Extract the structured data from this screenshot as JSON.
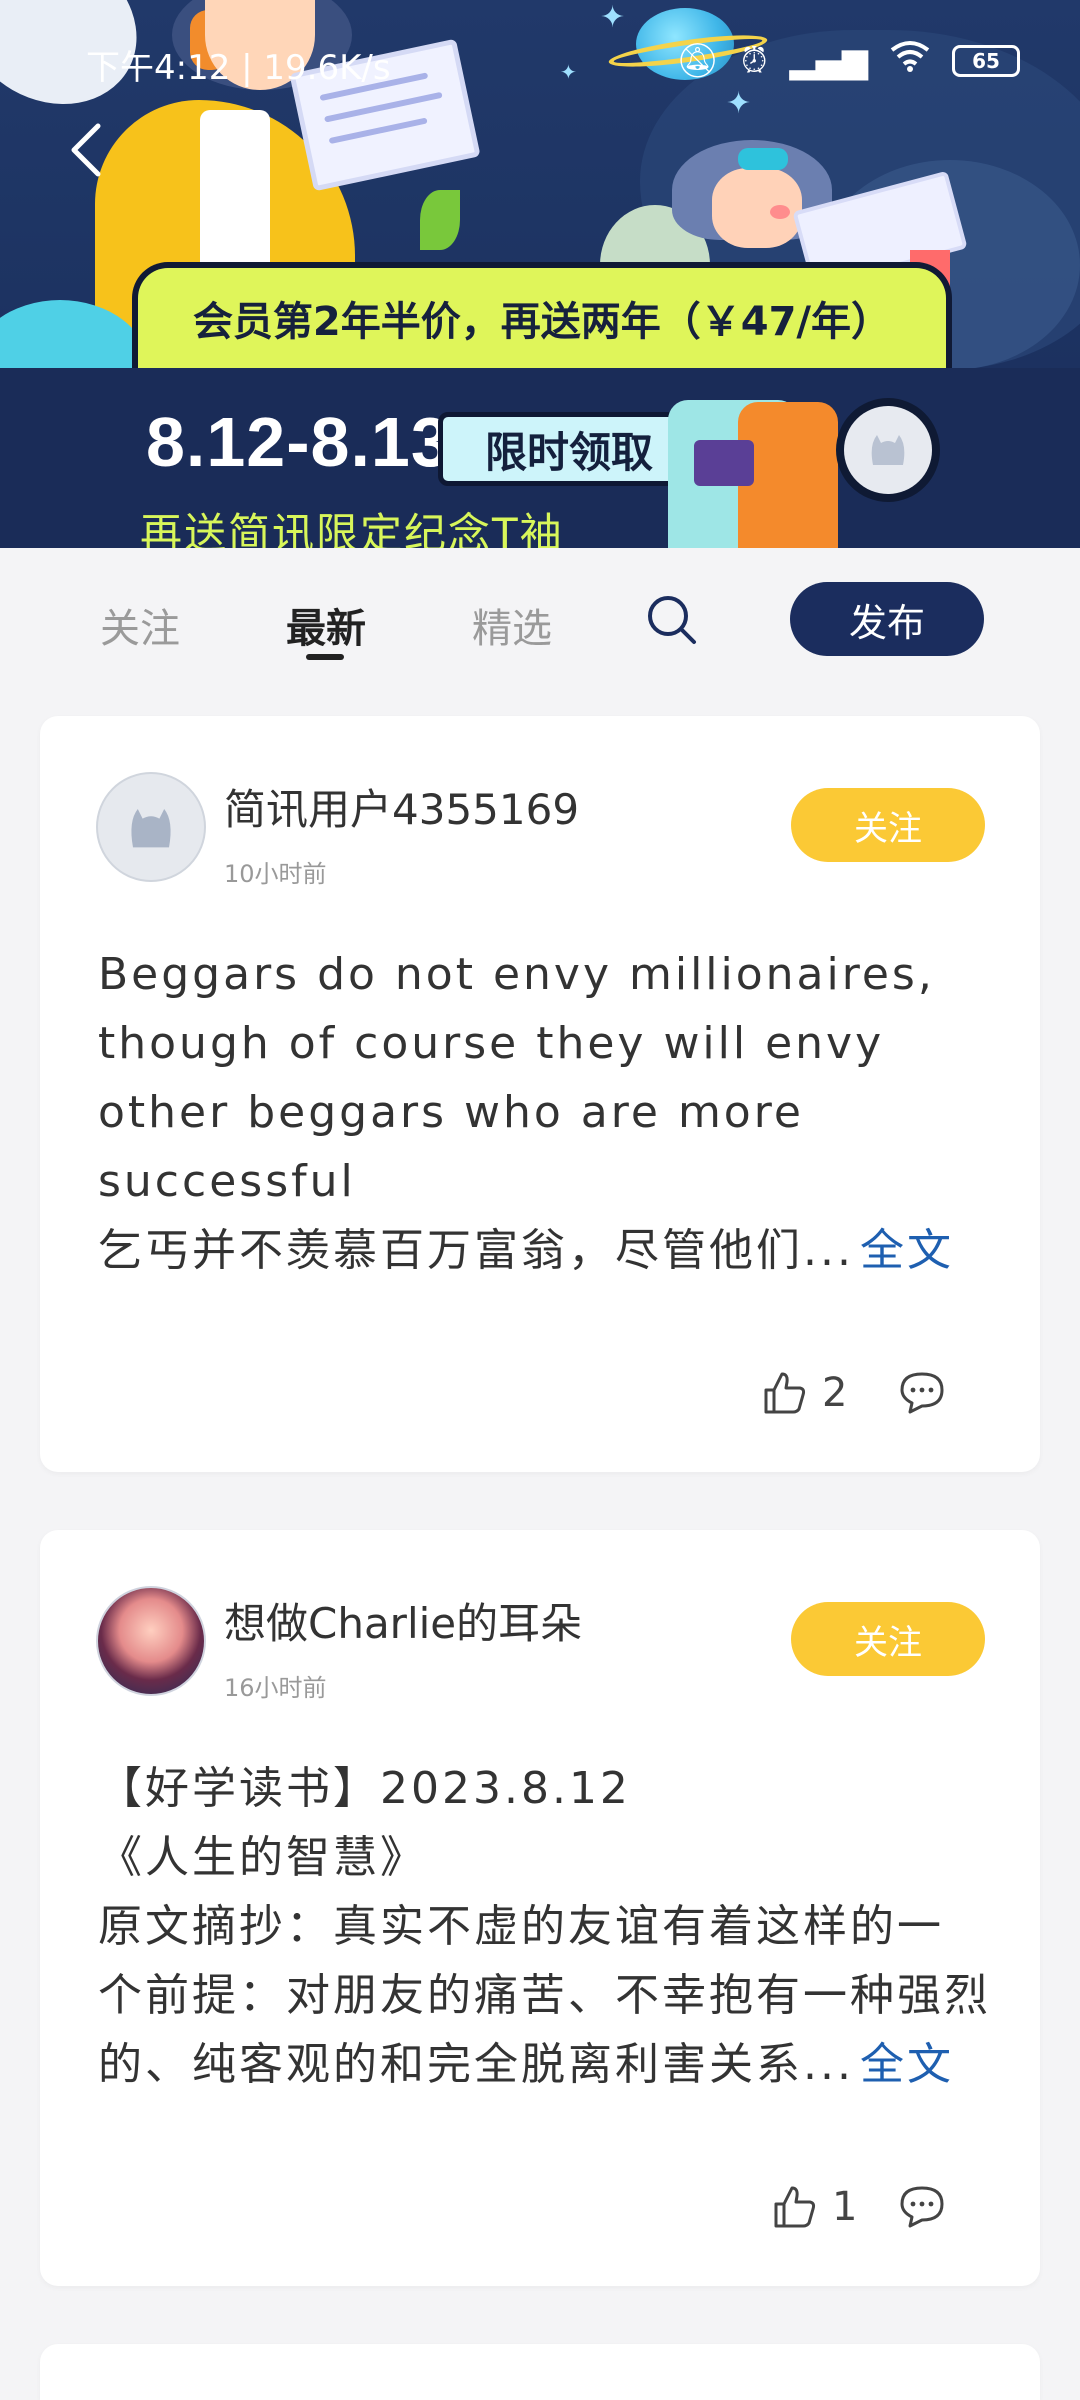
{
  "status_bar": {
    "time": "下午4:12 | 19.6K/s",
    "battery": "65"
  },
  "banner": {
    "promo_text": "会员第2年半价，再送两年（￥47/年）",
    "date_range": "8.12-8.13",
    "limited_badge": "限时领取",
    "gift_text": "再送简讯限定纪念T袖"
  },
  "tabs": [
    {
      "label": "关注",
      "active": false
    },
    {
      "label": "最新",
      "active": true
    },
    {
      "label": "精选",
      "active": false
    }
  ],
  "publish_label": "发布",
  "posts": [
    {
      "username": "简讯用户4355169",
      "time": "10小时前",
      "follow_label": "关注",
      "lines": [
        "Beggars do not envy millionaires,",
        "though of course they will envy",
        "other beggars who are more",
        "successful",
        "乞丐并不羡慕百万富翁，尽管他们..."
      ],
      "full_text_label": "全文",
      "likes": "2"
    },
    {
      "username": "想做Charlie的耳朵",
      "time": "16小时前",
      "follow_label": "关注",
      "lines": [
        "【好学读书】2023.8.12",
        "《人生的智慧》",
        "原文摘抄：真实不虚的友谊有着这样的一",
        "个前提：对朋友的痛苦、不幸抱有一种强烈",
        "的、纯客观的和完全脱离利害关系..."
      ],
      "full_text_label": "全文",
      "likes": "1"
    }
  ],
  "colors": {
    "banner_bg": "#1d2f5c",
    "promo_bg": "#dff55a",
    "follow_btn": "#fbc935",
    "publish_btn": "#1b2d5e",
    "link": "#1e5fb0"
  }
}
